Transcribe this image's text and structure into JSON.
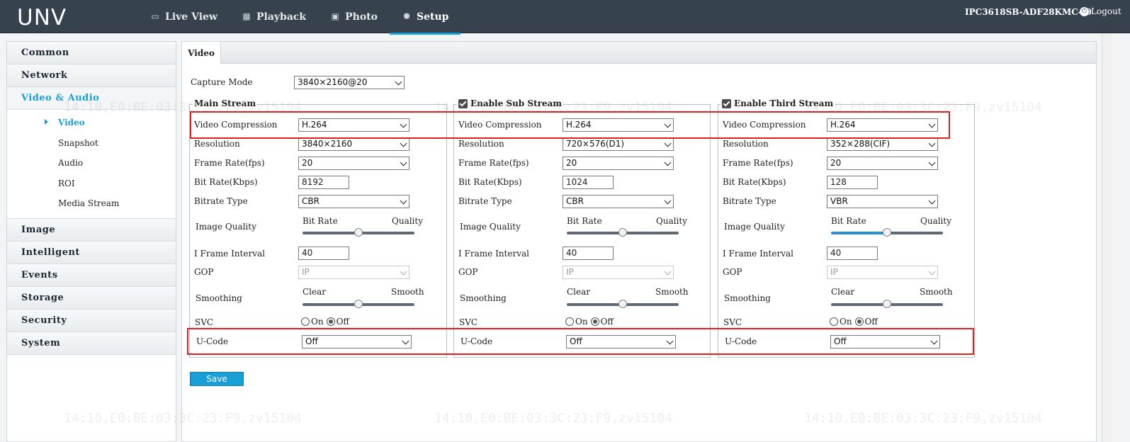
{
  "header": {
    "logo": "UNV",
    "nav": [
      {
        "label": "Live View",
        "icon": "monitor-icon"
      },
      {
        "label": "Playback",
        "icon": "film-icon"
      },
      {
        "label": "Photo",
        "icon": "image-icon"
      },
      {
        "label": "Setup",
        "icon": "gear-icon",
        "active": true
      }
    ],
    "device_name": "IPC3618SB-ADF28KMC-I0",
    "logout": "Logout"
  },
  "sidebar": {
    "groups": [
      {
        "label": "Common"
      },
      {
        "label": "Network"
      },
      {
        "label": "Video & Audio",
        "active": true
      },
      {
        "label": "Image"
      },
      {
        "label": "Intelligent"
      },
      {
        "label": "Events"
      },
      {
        "label": "Storage"
      },
      {
        "label": "Security"
      },
      {
        "label": "System"
      }
    ],
    "sub_items": [
      "Video",
      "Snapshot",
      "Audio",
      "ROI",
      "Media Stream"
    ]
  },
  "tab": "Video",
  "capture_mode": {
    "label": "Capture Mode",
    "value": "3840×2160@20"
  },
  "labels": {
    "video_compression": "Video Compression",
    "resolution": "Resolution",
    "frame_rate": "Frame Rate(fps)",
    "bit_rate": "Bit Rate(Kbps)",
    "bitrate_type": "Bitrate Type",
    "image_quality": "Image Quality",
    "i_frame_interval": "I Frame Interval",
    "gop": "GOP",
    "smoothing": "Smoothing",
    "svc": "SVC",
    "u_code": "U-Code",
    "slider_bit_rate": "Bit Rate",
    "slider_quality": "Quality",
    "slider_clear": "Clear",
    "slider_smooth": "Smooth",
    "on": "On",
    "off": "Off"
  },
  "streams": [
    {
      "title": "Main Stream",
      "checkbox": false,
      "video_compression": "H.264",
      "resolution": "3840×2160",
      "frame_rate": "20",
      "bit_rate": "8192",
      "bitrate_type": "CBR",
      "image_quality": 0.5,
      "i_frame_interval": "40",
      "gop": "IP",
      "smoothing": 0.5,
      "svc": "Off",
      "u_code": "Off"
    },
    {
      "title": "Enable Sub Stream",
      "checkbox": true,
      "video_compression": "H.264",
      "resolution": "720×576(D1)",
      "frame_rate": "20",
      "bit_rate": "1024",
      "bitrate_type": "CBR",
      "image_quality": 0.5,
      "i_frame_interval": "40",
      "gop": "IP",
      "smoothing": 0.5,
      "svc": "Off",
      "u_code": "Off"
    },
    {
      "title": "Enable Third Stream",
      "checkbox": true,
      "video_compression": "H.264",
      "resolution": "352×288(CIF)",
      "frame_rate": "20",
      "bit_rate": "128",
      "bitrate_type": "VBR",
      "image_quality": 0.5,
      "i_frame_interval": "40",
      "gop": "IP",
      "smoothing": 0.5,
      "svc": "Off",
      "u_code": "Off"
    }
  ],
  "save_label": "Save",
  "watermark": "14:10,E0:BE:03:3C:23:F9,zv15104"
}
